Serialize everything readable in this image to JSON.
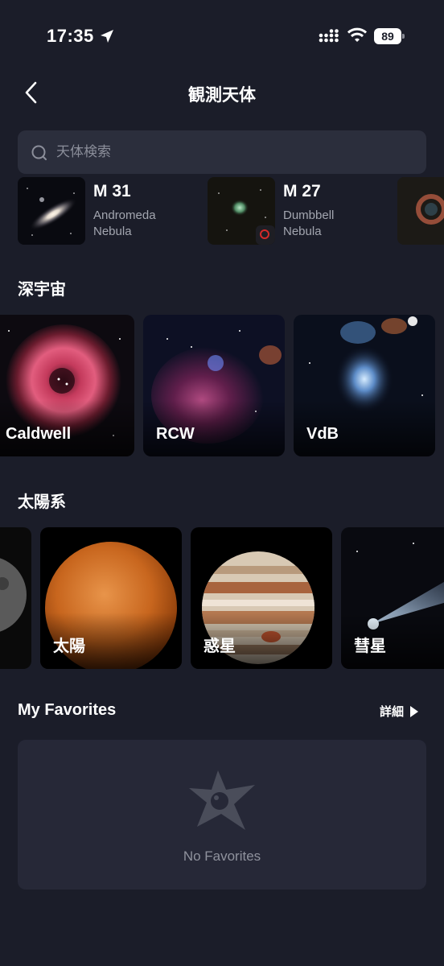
{
  "status_bar": {
    "time": "17:35",
    "battery": "89"
  },
  "nav": {
    "title": "観測天体"
  },
  "search": {
    "placeholder": "天体検索"
  },
  "recent": [
    {
      "name": "M 31",
      "sub1": "Andromeda",
      "sub2": "Nebula"
    },
    {
      "name": "M 27",
      "sub1": "Dumbbell",
      "sub2": "Nebula"
    }
  ],
  "deep_space": {
    "title": "深宇宙",
    "cards": [
      {
        "label": "Caldwell"
      },
      {
        "label": "RCW"
      },
      {
        "label": "VdB"
      }
    ]
  },
  "solar_system": {
    "title": "太陽系",
    "cards": [
      {
        "label": "太陽"
      },
      {
        "label": "惑星"
      },
      {
        "label": "彗星"
      }
    ]
  },
  "favorites": {
    "title": "My Favorites",
    "detail_label": "詳細",
    "empty_text": "No Favorites"
  },
  "colors": {
    "background": "#1b1d29",
    "surface": "#2b2e3c",
    "card_bg": "#262837",
    "muted_text": "#8f929d"
  }
}
